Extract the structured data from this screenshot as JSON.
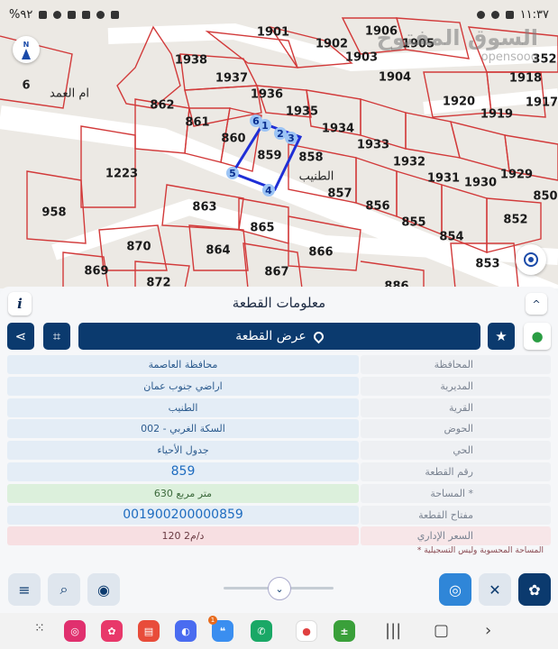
{
  "status_bar": {
    "left_text": "%٩٢",
    "time": "١١:٣٧",
    "left_icons": [
      "battery-icon",
      "signal-icon",
      "wifi-icon",
      "bluetooth-icon",
      "image-icon",
      "location-icon",
      "lock-icon"
    ],
    "right_icons": [
      "notification-icon",
      "weather-icon",
      "photo-icon",
      "clock-icon"
    ]
  },
  "map": {
    "compass_label": "N",
    "watermark": {
      "line1": "السوق المفتوح",
      "line2": "opensooq"
    },
    "place_labels": {
      "um_el_amad": "ام العمد",
      "tneib": "الطنيب",
      "six": "6"
    },
    "parcels": [
      "1901",
      "1902",
      "1906",
      "1905",
      "1903",
      "1904",
      "1938",
      "1937",
      "1936",
      "1935",
      "1934",
      "1933",
      "1932",
      "1931",
      "1930",
      "1929",
      "1920",
      "1919",
      "1918",
      "1917",
      "352",
      "850",
      "862",
      "861",
      "860",
      "859",
      "858",
      "857",
      "856",
      "855",
      "854",
      "853",
      "852",
      "1223",
      "958",
      "863",
      "865",
      "864",
      "866",
      "867",
      "870",
      "869",
      "872",
      "886"
    ],
    "vertices": [
      "1",
      "2",
      "3",
      "4",
      "5",
      "6"
    ]
  },
  "panel": {
    "title": "معلومات القطعة",
    "info_label": "i",
    "collapse_label": "^",
    "view_button_label": "عرض القطعة",
    "rows": [
      {
        "key": "المحافظة",
        "value": "محافظة العاصمة"
      },
      {
        "key": "المديرية",
        "value": "اراضي جنوب عمان"
      },
      {
        "key": "القرية",
        "value": "الطنيب"
      },
      {
        "key": "الحوض",
        "value": "السكة الغربي - 002"
      },
      {
        "key": "الحي",
        "value": "جدول الأحياء"
      },
      {
        "key": "رقم القطعة",
        "value": "859"
      },
      {
        "key": "المساحة *",
        "value": "630  متر مربع"
      },
      {
        "key": "مفتاح القطعة",
        "value": "001900200000859"
      },
      {
        "key": "السعر الإداري",
        "value": "120 د/م2"
      }
    ],
    "footnote": "* المساحة المحسوبة وليس التسجيلية"
  },
  "colors": {
    "navy": "#0b3a6e",
    "parcel_line": "#d23a3a",
    "selection": "#1f2fd6",
    "area_bg": "#dcf0dc",
    "price_bg": "#f7dfe2"
  },
  "nav_apps": [
    "instagram-app-icon",
    "flower-app-icon",
    "notes-app-icon",
    "browser-app-icon",
    "messages-app-icon",
    "phone-app-icon",
    "maps-app-icon",
    "calculator-app-icon"
  ],
  "messages_badge": "1"
}
